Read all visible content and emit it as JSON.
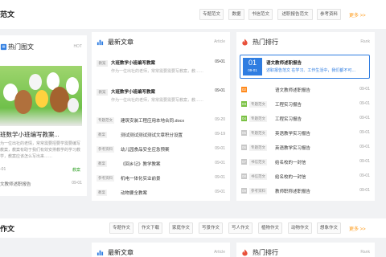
{
  "section1": {
    "title": "范文",
    "tags": [
      "专题范文",
      "数据",
      "书信范文",
      "述职报告范文",
      "参考资料"
    ],
    "more": "更多 >>"
  },
  "left_panel": {
    "title": "热门图文",
    "sub": "HOT",
    "hero_title": "班数学小班编写教案...",
    "hero_desc": "为一位出社的老情，常常需要招要学需要编写教案，教案有助于我们有效安排教学的学习教学，教案应该怎么写出来……",
    "hero_date": "-01",
    "hero_badge": "教案",
    "related": "文教师述职报告",
    "related_date": "09-01"
  },
  "mid_panel": {
    "title": "最新文章",
    "sub": "Article",
    "features": [
      {
        "badge": "教案",
        "title": "大班数学小班编写教案",
        "date": "09-01",
        "desc": "作为一位出社的老师，常常需要需要写教案，教……"
      },
      {
        "badge": "教案",
        "title": "大班数学小班编写教案",
        "date": "09-01",
        "desc": "作为一位出社的老师，常常需要需要写教案，教……"
      }
    ],
    "rows": [
      {
        "tag": "专题范文",
        "title": "建筑安装工程应用本地合同.docx",
        "date": "09-20"
      },
      {
        "tag": "教案",
        "title": "测试测试测试测试文章积分设置",
        "date": "09-19"
      },
      {
        "tag": "参考资料",
        "title": "幼儿园食品安全应急预案",
        "date": "09-01"
      },
      {
        "tag": "教案",
        "title": "《回乡记》教学教案",
        "date": "09-01"
      },
      {
        "tag": "参考资料",
        "title": "机电一体化实业前景",
        "date": "09-01"
      },
      {
        "tag": "教案",
        "title": "动物要全教案",
        "date": "09-01"
      }
    ]
  },
  "right_panel": {
    "title": "热门排行",
    "sub": "Rank",
    "top": {
      "num": "01",
      "date": "09-01",
      "title": "语文教师述职报告",
      "desc": "述职报告范文  在学习、工作生活中，我们都不可…"
    },
    "rows": [
      {
        "num": "02",
        "color": "#ff8a1c",
        "tag": "",
        "title": "语文教师述职报告",
        "date": "09-01"
      },
      {
        "num": "03",
        "color": "#7ac143",
        "tag": "专题范文",
        "title": "工程实习报告",
        "date": "09-01"
      },
      {
        "num": "04",
        "color": "#7ac143",
        "tag": "专题范文",
        "title": "工程实习报告",
        "date": "09-01"
      },
      {
        "num": "05",
        "color": "#c8c8c8",
        "tag": "专题范文",
        "title": "英语教学实习报告",
        "date": "09-01"
      },
      {
        "num": "06",
        "color": "#c8c8c8",
        "tag": "专题范文",
        "title": "英语教学实习报告",
        "date": "09-01"
      },
      {
        "num": "07",
        "color": "#c8c8c8",
        "tag": "书信范文",
        "title": "给名校的一封信",
        "date": "09-01"
      },
      {
        "num": "08",
        "color": "#c8c8c8",
        "tag": "书信范文",
        "title": "给名校的一封信",
        "date": "09-01"
      },
      {
        "num": "09",
        "color": "#c8c8c8",
        "tag": "参考资料",
        "title": "教师职称述职报告",
        "date": "09-01"
      }
    ]
  },
  "section2": {
    "title": "作文",
    "tags": [
      "专题作文",
      "作文下载",
      "家庭作文",
      "写景作文",
      "写人作文",
      "植物作文",
      "动物作文",
      "想象作文"
    ],
    "more": "更多 >>",
    "mid_title": "最新文章",
    "mid_sub": "Article",
    "right_title": "热门排行",
    "right_sub": "Rank"
  },
  "colors": {
    "accent": "#2f7de1",
    "more": "#ff9b1a",
    "hot": "#e8503a"
  }
}
